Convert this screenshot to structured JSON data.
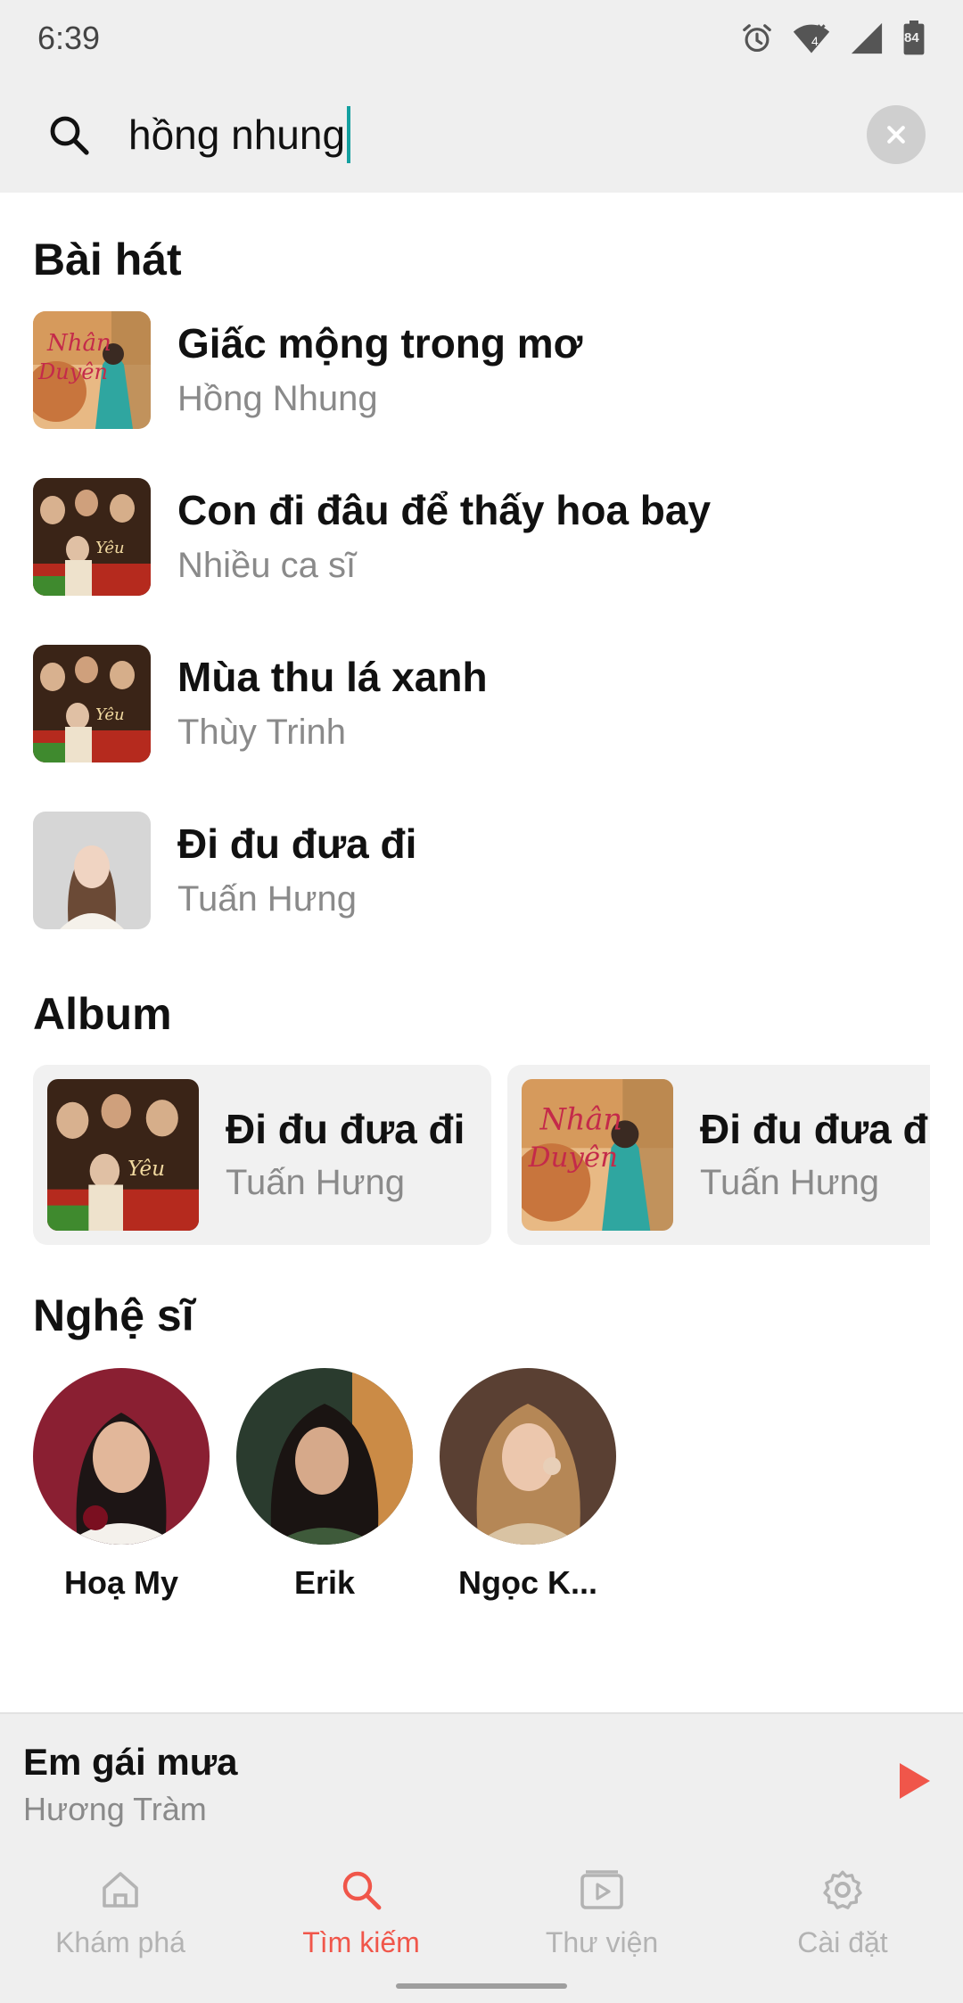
{
  "status_bar": {
    "time": "6:39",
    "battery": "84",
    "signal_badge": "4"
  },
  "search": {
    "value": "hồng nhung"
  },
  "sections": {
    "songs_title": "Bài hát",
    "albums_title": "Album",
    "artists_title": "Nghệ sĩ"
  },
  "songs": [
    {
      "title": "Giấc mộng trong mơ",
      "artist": "Hồng Nhung",
      "cover": "nhan-duyen"
    },
    {
      "title": "Con đi đâu để thấy hoa bay",
      "artist": "Nhiều ca sĩ",
      "cover": "group-photo"
    },
    {
      "title": "Mùa thu lá xanh",
      "artist": "Thùy Trinh",
      "cover": "group-photo"
    },
    {
      "title": "Đi đu đưa đi",
      "artist": "Tuấn Hưng",
      "cover": "portrait-woman"
    }
  ],
  "albums": [
    {
      "title": "Đi đu đưa đi",
      "artist": "Tuấn Hưng",
      "cover": "group-photo"
    },
    {
      "title": "Đi đu đưa đi",
      "artist": "Tuấn Hưng",
      "cover": "nhan-duyen"
    }
  ],
  "artists": [
    {
      "name": "Hoạ My"
    },
    {
      "name": "Erik"
    },
    {
      "name": "Ngọc K..."
    }
  ],
  "now_playing": {
    "title": "Em gái mưa",
    "artist": "Hương Tràm"
  },
  "nav": {
    "items": [
      {
        "label": "Khám phá",
        "icon": "home-icon",
        "active": false
      },
      {
        "label": "Tìm kiếm",
        "icon": "search-icon",
        "active": true
      },
      {
        "label": "Thư viện",
        "icon": "library-icon",
        "active": false
      },
      {
        "label": "Cài đặt",
        "icon": "gear-icon",
        "active": false
      }
    ]
  },
  "colors": {
    "accent": "#f0564a",
    "caret": "#14a0a0",
    "muted": "#8a8a8a",
    "bar_bg": "#efefef"
  }
}
